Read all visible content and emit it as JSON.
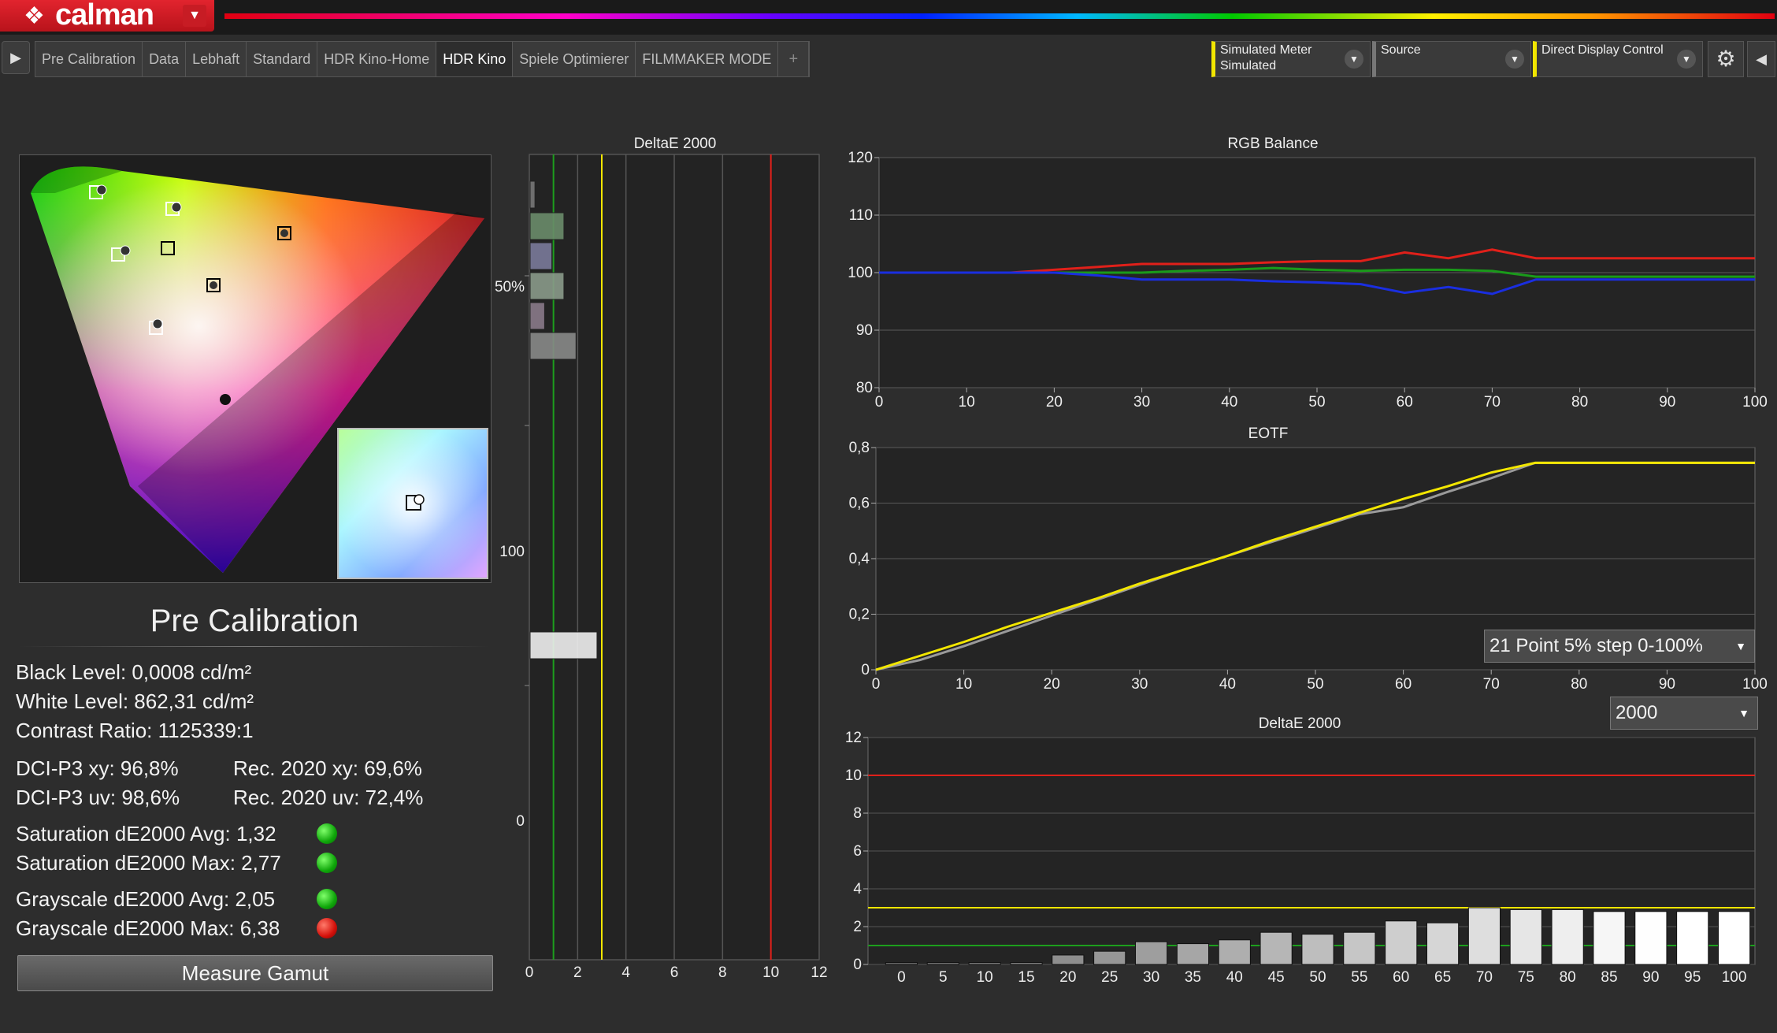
{
  "app": {
    "logo_text": "calman"
  },
  "tabs": [
    {
      "label": "Pre Calibration"
    },
    {
      "label": "Data"
    },
    {
      "label": "Lebhaft"
    },
    {
      "label": "Standard"
    },
    {
      "label": "HDR Kino-Home"
    },
    {
      "label": "HDR Kino"
    },
    {
      "label": "Spiele Optimierer"
    },
    {
      "label": "FILMMAKER MODE"
    },
    {
      "label": "+"
    }
  ],
  "active_tab": "HDR Kino",
  "controls": {
    "meter_line1": "Simulated Meter",
    "meter_line2": "Simulated",
    "source": "Source",
    "display": "Direct Display Control"
  },
  "page_title": "Pre Calibration",
  "stats": {
    "black": "Black Level: 0,0008 cd/m²",
    "white": "White Level: 862,31 cd/m²",
    "contrast": "Contrast Ratio: 1125339:1",
    "dci_xy": "DCI-P3 xy: 96,8%",
    "rec_xy": "Rec. 2020 xy: 69,6%",
    "dci_uv": "DCI-P3 uv: 98,6%",
    "rec_uv": "Rec. 2020 uv: 72,4%",
    "sat_avg": "Saturation dE2000 Avg: 1,32",
    "sat_max": "Saturation dE2000 Max: 2,77",
    "gray_avg": "Grayscale dE2000 Avg: 2,05",
    "gray_max": "Grayscale dE2000 Max: 6,38"
  },
  "status_colors": {
    "good": "#12b00c",
    "bad": "#d4100a"
  },
  "measure_button": "Measure Gamut",
  "dropdowns": {
    "pattern": "21 Point 5% step 0-100%",
    "target": "2000"
  },
  "chart_data": [
    {
      "type": "bar",
      "title": "DeltaE 2000",
      "orientation": "horizontal",
      "xlim": [
        0,
        12
      ],
      "x_ticks": [
        "0",
        "2",
        "4",
        "6",
        "8",
        "10",
        "12"
      ],
      "y_tick_labels": [
        "50%",
        "100",
        "0"
      ],
      "thresholds": [
        {
          "value": 1,
          "color": "#1d9e1d"
        },
        {
          "value": 3,
          "color": "#f2e600"
        },
        {
          "value": 10,
          "color": "#e0201a"
        }
      ],
      "values": [
        0.2,
        1.4,
        0.9,
        1.4,
        0.6,
        1.9,
        2.77
      ]
    },
    {
      "type": "line",
      "title": "RGB Balance",
      "ylim": [
        80,
        120
      ],
      "y_ticks": [
        "80",
        "90",
        "100",
        "110",
        "120"
      ],
      "x_ticks": [
        "0",
        "10",
        "20",
        "30",
        "40",
        "50",
        "60",
        "70",
        "80",
        "90",
        "100"
      ],
      "x": [
        0,
        5,
        10,
        15,
        20,
        25,
        30,
        35,
        40,
        45,
        50,
        55,
        60,
        65,
        70,
        75,
        80,
        85,
        90,
        95,
        100
      ],
      "series": [
        {
          "color": "#e0201a",
          "values": [
            100,
            100,
            100,
            100,
            100.5,
            101,
            101.5,
            101.5,
            101.5,
            101.8,
            102,
            102,
            103.5,
            102.5,
            104,
            102.5,
            102.5,
            102.5,
            102.5,
            102.5,
            102.5
          ]
        },
        {
          "color": "#1a9a1a",
          "values": [
            100,
            100,
            100,
            100,
            100,
            100,
            100,
            100.3,
            100.5,
            100.8,
            100.5,
            100.3,
            100.5,
            100.5,
            100.3,
            99.3,
            99.3,
            99.3,
            99.3,
            99.3,
            99.3
          ]
        },
        {
          "color": "#1a2ee0",
          "values": [
            100,
            100,
            100,
            100,
            100,
            99.5,
            98.8,
            98.8,
            98.8,
            98.5,
            98.3,
            98,
            96.5,
            97.5,
            96.3,
            98.8,
            98.8,
            98.8,
            98.8,
            98.8,
            98.8
          ]
        }
      ]
    },
    {
      "type": "line",
      "title": "EOTF",
      "ylim": [
        0,
        0.8
      ],
      "y_ticks": [
        "0",
        "0,2",
        "0,4",
        "0,6",
        "0,8"
      ],
      "x_ticks": [
        "0",
        "10",
        "20",
        "30",
        "40",
        "50",
        "60",
        "70",
        "80",
        "90",
        "100"
      ],
      "x": [
        0,
        5,
        10,
        15,
        20,
        25,
        30,
        35,
        40,
        45,
        50,
        55,
        60,
        65,
        70,
        75,
        80,
        85,
        90,
        95,
        100
      ],
      "series": [
        {
          "color": "#9a9a9a",
          "values": [
            0,
            0.035,
            0.085,
            0.14,
            0.195,
            0.25,
            0.305,
            0.36,
            0.41,
            0.46,
            0.51,
            0.56,
            0.585,
            0.64,
            0.69,
            0.745,
            0.745,
            0.745,
            0.745,
            0.745,
            0.745
          ]
        },
        {
          "color": "#f2e600",
          "values": [
            0,
            0.05,
            0.1,
            0.155,
            0.205,
            0.255,
            0.31,
            0.36,
            0.41,
            0.465,
            0.515,
            0.565,
            0.615,
            0.66,
            0.71,
            0.745,
            0.745,
            0.745,
            0.745,
            0.745,
            0.745
          ]
        }
      ]
    },
    {
      "type": "bar",
      "title": "DeltaE 2000",
      "ylim": [
        0,
        12
      ],
      "y_ticks": [
        "0",
        "2",
        "4",
        "6",
        "8",
        "10",
        "12"
      ],
      "categories": [
        "0",
        "5",
        "10",
        "15",
        "20",
        "25",
        "30",
        "35",
        "40",
        "45",
        "50",
        "55",
        "60",
        "65",
        "70",
        "75",
        "80",
        "85",
        "90",
        "95",
        "100"
      ],
      "values": [
        0.1,
        0.1,
        0.1,
        0.1,
        0.5,
        0.7,
        1.2,
        1.1,
        1.3,
        1.7,
        1.6,
        1.7,
        2.3,
        2.2,
        3.0,
        2.9,
        2.9,
        2.8,
        2.8,
        2.8,
        2.8
      ],
      "thresholds": [
        {
          "value": 1,
          "color": "#1d9e1d"
        },
        {
          "value": 3,
          "color": "#f2e600"
        },
        {
          "value": 10,
          "color": "#e0201a"
        }
      ]
    }
  ]
}
